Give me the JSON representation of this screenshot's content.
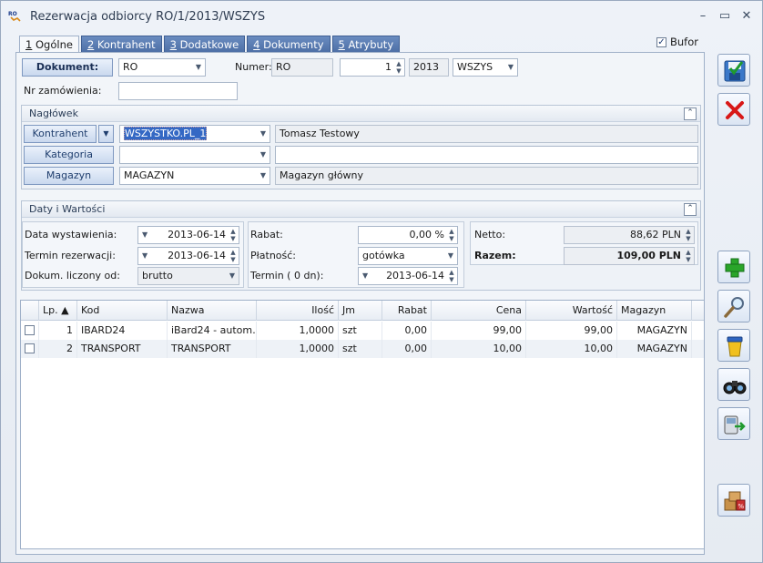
{
  "window": {
    "title": "Rezerwacja odbiorcy RO/1/2013/WSZYS",
    "icon_text": "RO",
    "minimize": "–",
    "maximize": "▭",
    "close": "✕"
  },
  "tabs": [
    {
      "hotkey": "1",
      "label": " Ogólne"
    },
    {
      "hotkey": "2",
      "label": " Kontrahent"
    },
    {
      "hotkey": "3",
      "label": " Dodatkowe"
    },
    {
      "hotkey": "4",
      "label": " Dokumenty"
    },
    {
      "hotkey": "5",
      "label": " Atrybuty"
    }
  ],
  "bufor": {
    "label": "Bufor",
    "checked": "✓"
  },
  "header": {
    "dokument_btn": "Dokument:",
    "dokument_value": "RO",
    "numer_label": "Numer:",
    "numer_prefix": "RO",
    "numer_value": "1",
    "numer_year": "2013",
    "numer_series": "WSZYS",
    "nr_zam_label": "Nr zamówienia:",
    "nr_zam_value": ""
  },
  "naglowek": {
    "title": "Nagłówek",
    "kontrahent_btn": "Kontrahent",
    "kontrahent_code": "WSZYSTKO.PL_1",
    "kontrahent_name": "Tomasz Testowy",
    "kategoria_btn": "Kategoria",
    "kategoria_code": "",
    "kategoria_desc": "",
    "magazyn_btn": "Magazyn",
    "magazyn_code": "MAGAZYN",
    "magazyn_name": "Magazyn główny"
  },
  "daty": {
    "title": "Daty i Wartości",
    "data_wyst_label": "Data wystawienia:",
    "data_wyst": "2013-06-14",
    "termin_rez_label": "Termin rezerwacji:",
    "termin_rez": "2013-06-14",
    "dokum_label": "Dokum. liczony od:",
    "dokum_value": "brutto",
    "rabat_label": "Rabat:",
    "rabat_value": "0,00 %",
    "platnosc_label": "Płatność:",
    "platnosc_value": "gotówka",
    "termin_label": "Termin  (   0 dn):",
    "termin_value": "2013-06-14",
    "netto_label": "Netto:",
    "netto_value": "88,62 PLN",
    "razem_label": "Razem:",
    "razem_value": "109,00 PLN"
  },
  "table": {
    "columns": [
      "Lp. ▲",
      "Kod",
      "Nazwa",
      "Ilość",
      "Jm",
      "Rabat",
      "Cena",
      "Wartość",
      "Magazyn"
    ],
    "rows": [
      {
        "lp": "1",
        "kod": "IBARD24",
        "nazwa": "iBard24 - autom…",
        "ilosc": "1,0000",
        "jm": "szt",
        "rabat": "0,00",
        "cena": "99,00",
        "wartosc": "99,00",
        "magazyn": "MAGAZYN"
      },
      {
        "lp": "2",
        "kod": "TRANSPORT",
        "nazwa": "TRANSPORT",
        "ilosc": "1,0000",
        "jm": "szt",
        "rabat": "0,00",
        "cena": "10,00",
        "wartosc": "10,00",
        "magazyn": "MAGAZYN"
      }
    ]
  },
  "toolbar": {
    "save": "save-icon",
    "cancel": "cancel-icon",
    "add": "add-icon",
    "edit": "edit-icon",
    "delete": "delete-icon",
    "search": "binoculars-icon",
    "export": "export-icon",
    "pack": "package-icon"
  },
  "colors": {
    "tab_blue": "#4c6ea5",
    "accent": "#1f3e6e",
    "cancel_red": "#d81818",
    "add_green": "#2aa52a"
  }
}
